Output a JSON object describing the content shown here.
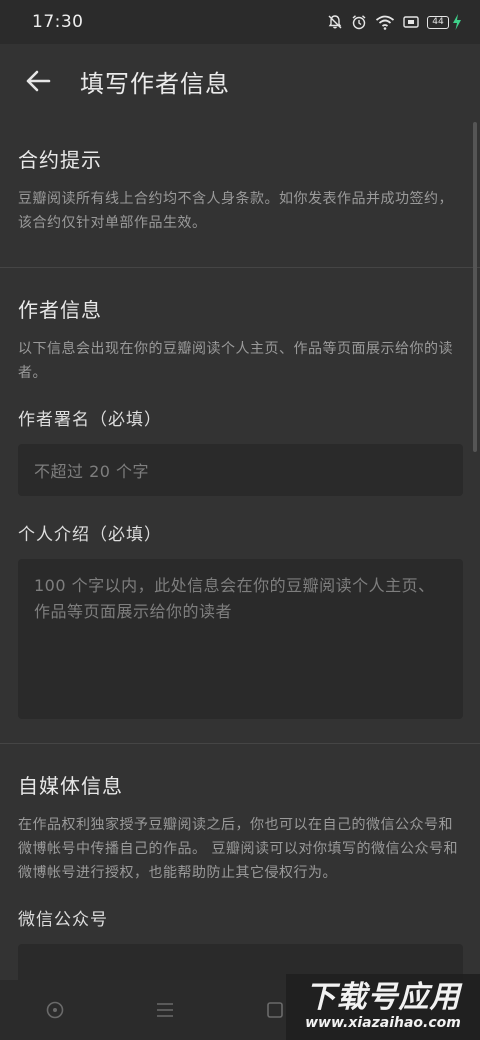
{
  "status_bar": {
    "time": "17:30",
    "battery_level": "44",
    "icons": [
      "mute-bell-icon",
      "alarm-icon",
      "wifi-icon",
      "sim-icon",
      "battery-icon",
      "charging-icon"
    ]
  },
  "app_bar": {
    "title": "填写作者信息"
  },
  "contract_section": {
    "title": "合约提示",
    "desc": "豆瓣阅读所有线上合约均不含人身条款。如你发表作品并成功签约，该合约仅针对单部作品生效。"
  },
  "author_section": {
    "title": "作者信息",
    "desc": "以下信息会出现在你的豆瓣阅读个人主页、作品等页面展示给你的读者。",
    "pen_name": {
      "label": "作者署名（必填）",
      "placeholder": "不超过 20 个字",
      "value": ""
    },
    "intro": {
      "label": "个人介绍（必填）",
      "placeholder": "100 个字以内，此处信息会在你的豆瓣阅读个人主页、作品等页面展示给你的读者",
      "value": ""
    }
  },
  "media_section": {
    "title": "自媒体信息",
    "desc": "在作品权利独家授予豆瓣阅读之后，你也可以在自己的微信公众号和微博帐号中传播自己的作品。 豆瓣阅读可以对你填写的微信公众号和微博帐号进行授权，也能帮助防止其它侵权行为。",
    "wechat_label": "微信公众号"
  },
  "nav_bar": {
    "icons": [
      "home-circle-icon",
      "menu-icon",
      "recent-apps-icon"
    ]
  },
  "watermark": {
    "main": "下载号应用",
    "sub": "www.xiazaihao.com"
  },
  "colors": {
    "background": "#333333",
    "input_bg": "#2a2a2a",
    "text_primary": "#e8e8e8",
    "text_secondary": "#9a9a9a",
    "placeholder": "#7e7e7e",
    "charging": "#3fd18a"
  }
}
